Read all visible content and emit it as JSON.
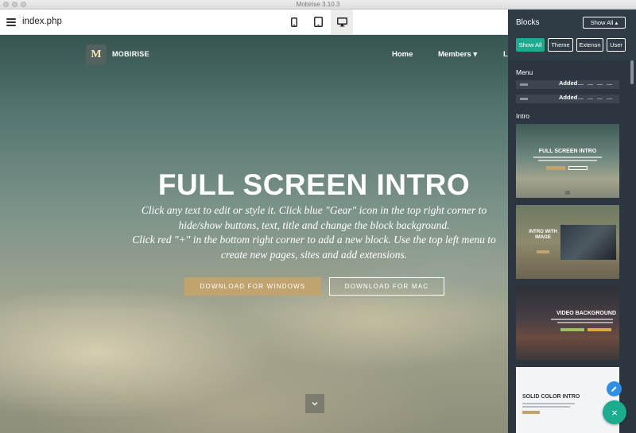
{
  "window": {
    "title": "Mobirise 3.10.3"
  },
  "toolbar": {
    "filename": "index.php",
    "menu_icon": "hamburger-icon",
    "device_icons": [
      "phone-icon",
      "tablet-icon",
      "desktop-icon"
    ],
    "active_device": "desktop"
  },
  "site": {
    "logo_letter": "M",
    "brand": "MOBIRISE",
    "nav": [
      "Home",
      "Members ▾",
      "L"
    ],
    "hero_title": "FULL SCREEN INTRO",
    "hero_text_1": "Click any text to edit or style it. Click blue \"Gear\" icon in the top right corner to hide/show buttons, text, title and change the block background.",
    "hero_text_2": "Click red \"+\" in the bottom right corner to add a new block. Use the top left menu to create new pages, sites and add extensions.",
    "button_windows": "DOWNLOAD FOR WINDOWS",
    "button_mac": "DOWNLOAD FOR MAC",
    "scroll_icon": "chevron-down-icon",
    "colors": {
      "accent_button": "#c0a36f"
    }
  },
  "panel": {
    "title": "Blocks",
    "dropdown": "Show All ▴",
    "filters": [
      "Show All",
      "Theme",
      "Extensn",
      "User"
    ],
    "active_filter": "Show All",
    "sections": {
      "menu": {
        "label": "Menu",
        "items": [
          {
            "status": "Added"
          },
          {
            "status": "Added"
          }
        ]
      },
      "intro": {
        "label": "Intro",
        "thumbnails": [
          {
            "title": "FULL SCREEN INTRO"
          },
          {
            "title": "INTRO WITH IMAGE"
          },
          {
            "title": "VIDEO BACKGROUND"
          },
          {
            "title": "SOLID COLOR INTRO"
          }
        ]
      }
    },
    "fab_edit_icon": "pencil-icon",
    "fab_add_icon": "close-icon",
    "fab_add_label": "×",
    "colors": {
      "panel_bg": "#2f3b45",
      "active_filter": "#1bab8f",
      "fab_edit": "#2f8fe6"
    }
  }
}
